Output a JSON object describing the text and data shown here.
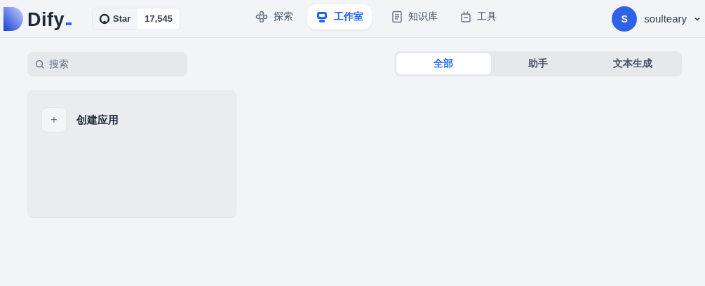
{
  "logo": {
    "text": "Dify"
  },
  "github": {
    "label": "Star",
    "count": "17,545"
  },
  "nav": [
    {
      "label": "探索",
      "selected": false
    },
    {
      "label": "工作室",
      "selected": true
    },
    {
      "label": "知识库",
      "selected": false
    },
    {
      "label": "工具",
      "selected": false
    }
  ],
  "user": {
    "initial": "S",
    "name": "soulteary"
  },
  "search": {
    "placeholder": "搜索"
  },
  "filters": [
    {
      "label": "全部",
      "selected": true
    },
    {
      "label": "助手",
      "selected": false
    },
    {
      "label": "文本生成",
      "selected": false
    }
  ],
  "create_card": {
    "icon": "+",
    "label": "创建应用"
  }
}
